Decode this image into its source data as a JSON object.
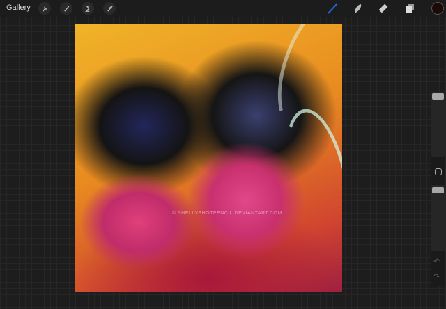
{
  "toolbar": {
    "gallery_label": "Gallery",
    "left_tools": [
      "wrench-icon",
      "magic-wand-icon",
      "selection-icon",
      "transform-arrow-icon"
    ],
    "right_tools": [
      "brush-icon",
      "smudge-icon",
      "eraser-icon",
      "layers-icon"
    ],
    "active_tool": "brush",
    "accent": "#1e6fe0",
    "current_color": "#1a0a08"
  },
  "canvas": {
    "watermark": "© SHELLYSHOTPENCIL.DEVIANTART.COM"
  },
  "sidebar": {
    "brush_size": 0.95,
    "opacity": 0.95,
    "undo_icon": "undo-icon",
    "redo_icon": "redo-icon"
  }
}
